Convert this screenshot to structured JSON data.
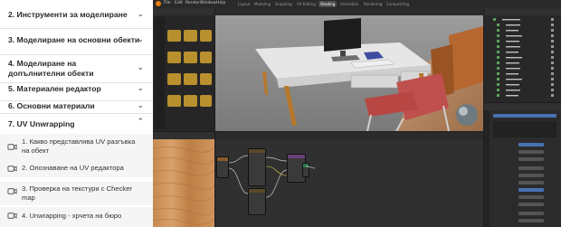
{
  "course": {
    "sections": [
      {
        "label": "2. Инструменти за моделиране",
        "expanded": false
      },
      {
        "label": "3. Моделиране на основни обекти",
        "expanded": false
      },
      {
        "label": "4. Моделиране на допълнителни обекти",
        "expanded": false
      },
      {
        "label": "5. Материален редактор",
        "expanded": false
      },
      {
        "label": "6. Основни материали",
        "expanded": false
      },
      {
        "label": "7. UV Unwrapping",
        "expanded": true
      }
    ],
    "lessons": [
      {
        "label": "1. Какво представлява UV разгъвка на обект",
        "icon": "video-icon"
      },
      {
        "label": "2. Опознаване на UV редактора",
        "icon": "video-icon"
      },
      {
        "label": "3. Проверка на текстури с Checker map",
        "icon": "video-icon"
      },
      {
        "label": "4. Unwrapping - хрчета на бюро",
        "icon": "video-icon"
      }
    ]
  },
  "blender": {
    "menus": [
      "File",
      "Edit",
      "Render",
      "Window",
      "Help"
    ],
    "workspace_tabs": [
      "Layout",
      "Modeling",
      "Sculpting",
      "UV Editing",
      "Texture Paint",
      "Shading",
      "Animation",
      "Rendering",
      "Compositing"
    ],
    "active_tab": "Shading",
    "colors": {
      "wood": "#c58a4f",
      "chair": "#c0504d",
      "desk": "#e2e2e2",
      "selection": "#4772b3",
      "node_header": "#6a3f78"
    }
  }
}
